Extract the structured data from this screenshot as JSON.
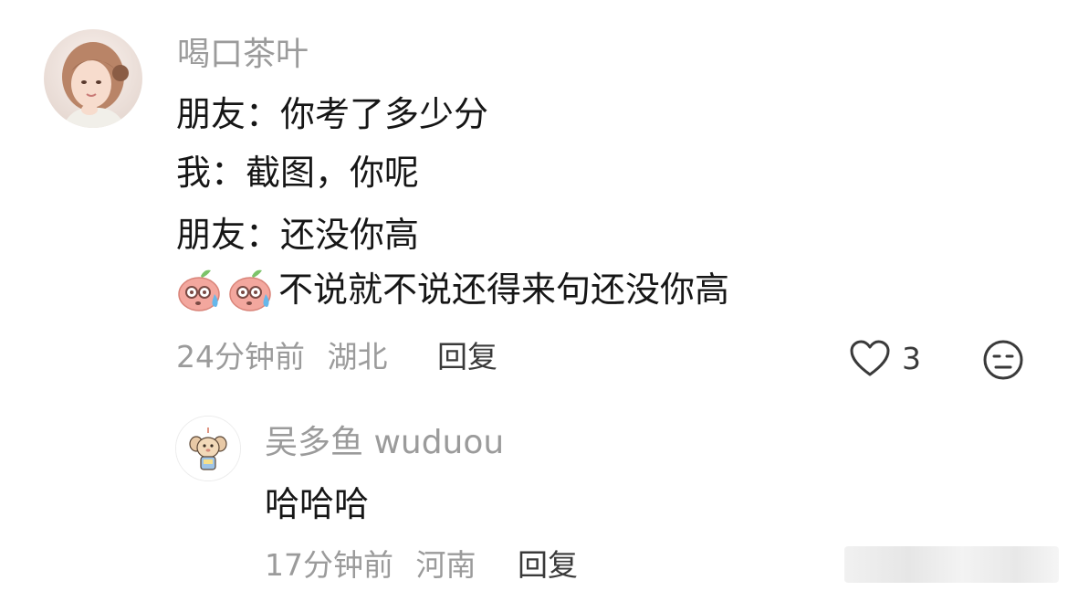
{
  "comment": {
    "username": "喝口茶叶",
    "lines": [
      "朋友：你考了多少分",
      "我：截图，你呢",
      "朋友：还没你高"
    ],
    "emoji_line_text": "不说就不说还得来句还没你高",
    "emoji_icons": [
      "sweat-peach-emoji",
      "sweat-peach-emoji"
    ],
    "time": "24分钟前",
    "location": "湖北",
    "reply_label": "回复",
    "like_count": "3",
    "icons": {
      "like": "heart-outline-icon",
      "dislike": "unamused-face-icon"
    }
  },
  "reply": {
    "username": "吴多鱼 wuduou",
    "text": "哈哈哈",
    "time": "17分钟前",
    "location": "河南",
    "reply_label": "回复"
  },
  "colors": {
    "text_primary": "#161616",
    "text_secondary": "#9b9b9b",
    "background": "#ffffff",
    "emoji_peach": "#f3a79e",
    "emoji_leaf": "#7cc36a",
    "emoji_sweat": "#66b7ea"
  }
}
